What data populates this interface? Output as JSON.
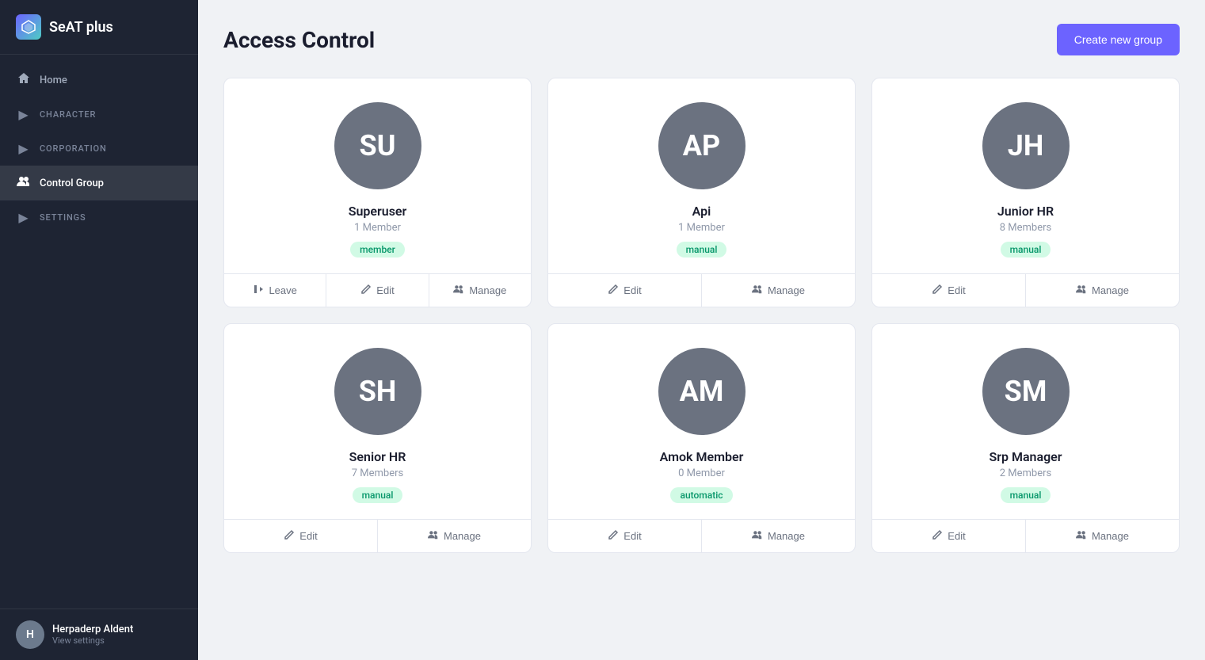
{
  "app": {
    "logo_label": "SeAT plus",
    "logo_initials": "S"
  },
  "sidebar": {
    "items": [
      {
        "id": "home",
        "label": "Home",
        "icon": "🏠",
        "type": "link",
        "active": false
      },
      {
        "id": "character",
        "label": "CHARACTER",
        "icon": "▶",
        "type": "section",
        "active": false
      },
      {
        "id": "corporation",
        "label": "CORPORATION",
        "icon": "▶",
        "type": "section",
        "active": false
      },
      {
        "id": "control-group",
        "label": "Control Group",
        "icon": "👥",
        "type": "link",
        "active": true
      },
      {
        "id": "settings",
        "label": "SETTINGS",
        "icon": "▶",
        "type": "section",
        "active": false
      }
    ]
  },
  "footer": {
    "name": "Herpaderp Aldent",
    "sub_label": "View settings"
  },
  "header": {
    "title": "Access Control",
    "create_button_label": "Create new group"
  },
  "groups": [
    {
      "id": "superuser",
      "initials": "SU",
      "name": "Superuser",
      "members": "1 Member",
      "badge": "member",
      "badge_label": "member",
      "actions": [
        "Leave",
        "Edit",
        "Manage"
      ]
    },
    {
      "id": "api",
      "initials": "AP",
      "name": "Api",
      "members": "1 Member",
      "badge": "manual",
      "badge_label": "manual",
      "actions": [
        "Edit",
        "Manage"
      ]
    },
    {
      "id": "junior-hr",
      "initials": "JH",
      "name": "Junior HR",
      "members": "8 Members",
      "badge": "manual",
      "badge_label": "manual",
      "actions": [
        "Edit",
        "Manage"
      ]
    },
    {
      "id": "senior-hr",
      "initials": "SH",
      "name": "Senior HR",
      "members": "7 Members",
      "badge": "manual",
      "badge_label": "manual",
      "actions": [
        "Edit",
        "Manage"
      ]
    },
    {
      "id": "amok-member",
      "initials": "AM",
      "name": "Amok Member",
      "members": "0 Member",
      "badge": "automatic",
      "badge_label": "automatic",
      "actions": [
        "Edit",
        "Manage"
      ]
    },
    {
      "id": "srp-manager",
      "initials": "SM",
      "name": "Srp Manager",
      "members": "2 Members",
      "badge": "manual",
      "badge_label": "manual",
      "actions": [
        "Edit",
        "Manage"
      ]
    }
  ]
}
